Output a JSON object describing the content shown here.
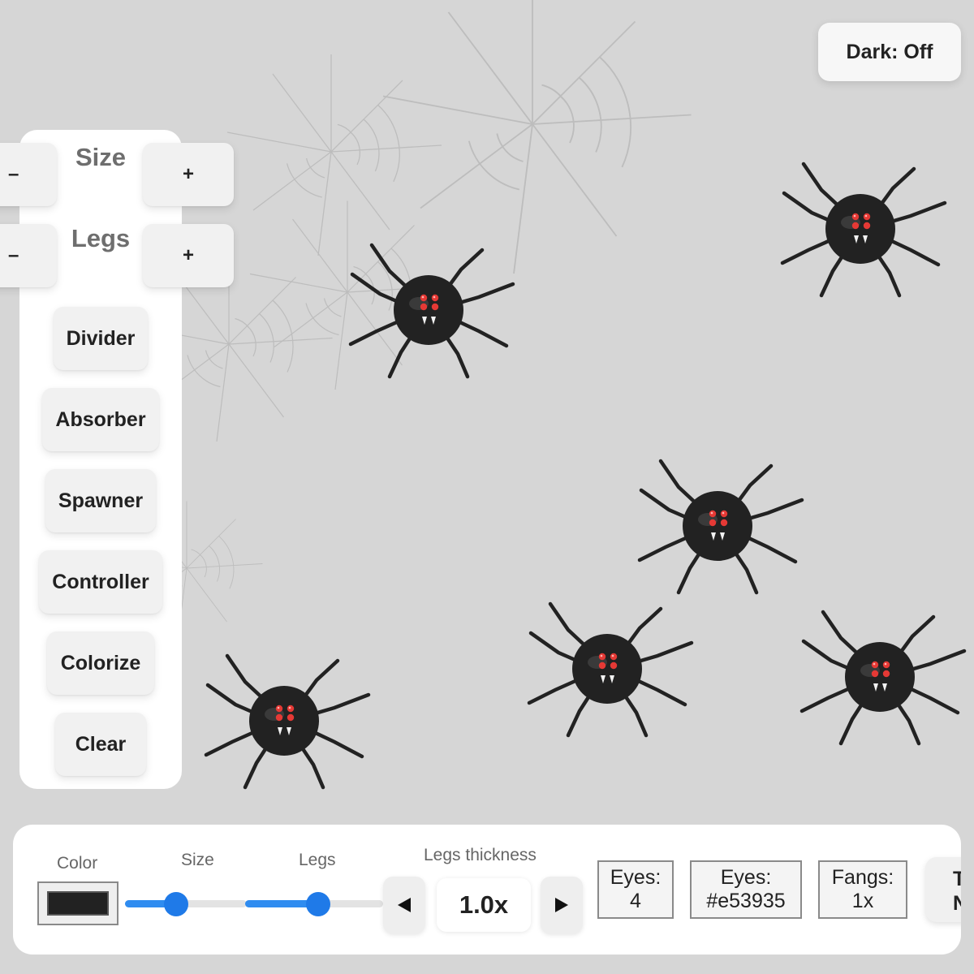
{
  "header": {
    "dark_toggle_label": "Dark: Off"
  },
  "side_panel": {
    "size": {
      "title": "Size",
      "minus": "–",
      "plus": "+"
    },
    "legs": {
      "title": "Legs",
      "minus": "–",
      "plus": "+"
    },
    "tools": [
      "Divider",
      "Absorber",
      "Spawner",
      "Controller",
      "Colorize",
      "Clear"
    ]
  },
  "bottom_bar": {
    "color_label": "Color",
    "color_value": "#222222",
    "size_label": "Size",
    "size_fraction": 0.42,
    "legs_label": "Legs",
    "legs_fraction": 0.53,
    "thickness_label": "Legs thickness",
    "thickness_value": "1.0x",
    "prev_icon": "triangle-left-icon",
    "next_icon": "triangle-right-icon",
    "eyes_count": {
      "line1": "Eyes:",
      "line2": "4"
    },
    "eyes_color": {
      "line1": "Eyes:",
      "line2": "#e53935"
    },
    "fangs": {
      "line1": "Fangs:",
      "line2": "1x"
    },
    "cutoff_button": {
      "line1": "Te",
      "line2": "N"
    }
  },
  "colors": {
    "background": "#d6d6d6",
    "spider_body": "#222222",
    "spider_eye": "#e53935",
    "accent": "#2f8cf0"
  },
  "icons": [
    "web-icon",
    "spider-icon",
    "triangle-left-icon",
    "triangle-right-icon"
  ]
}
